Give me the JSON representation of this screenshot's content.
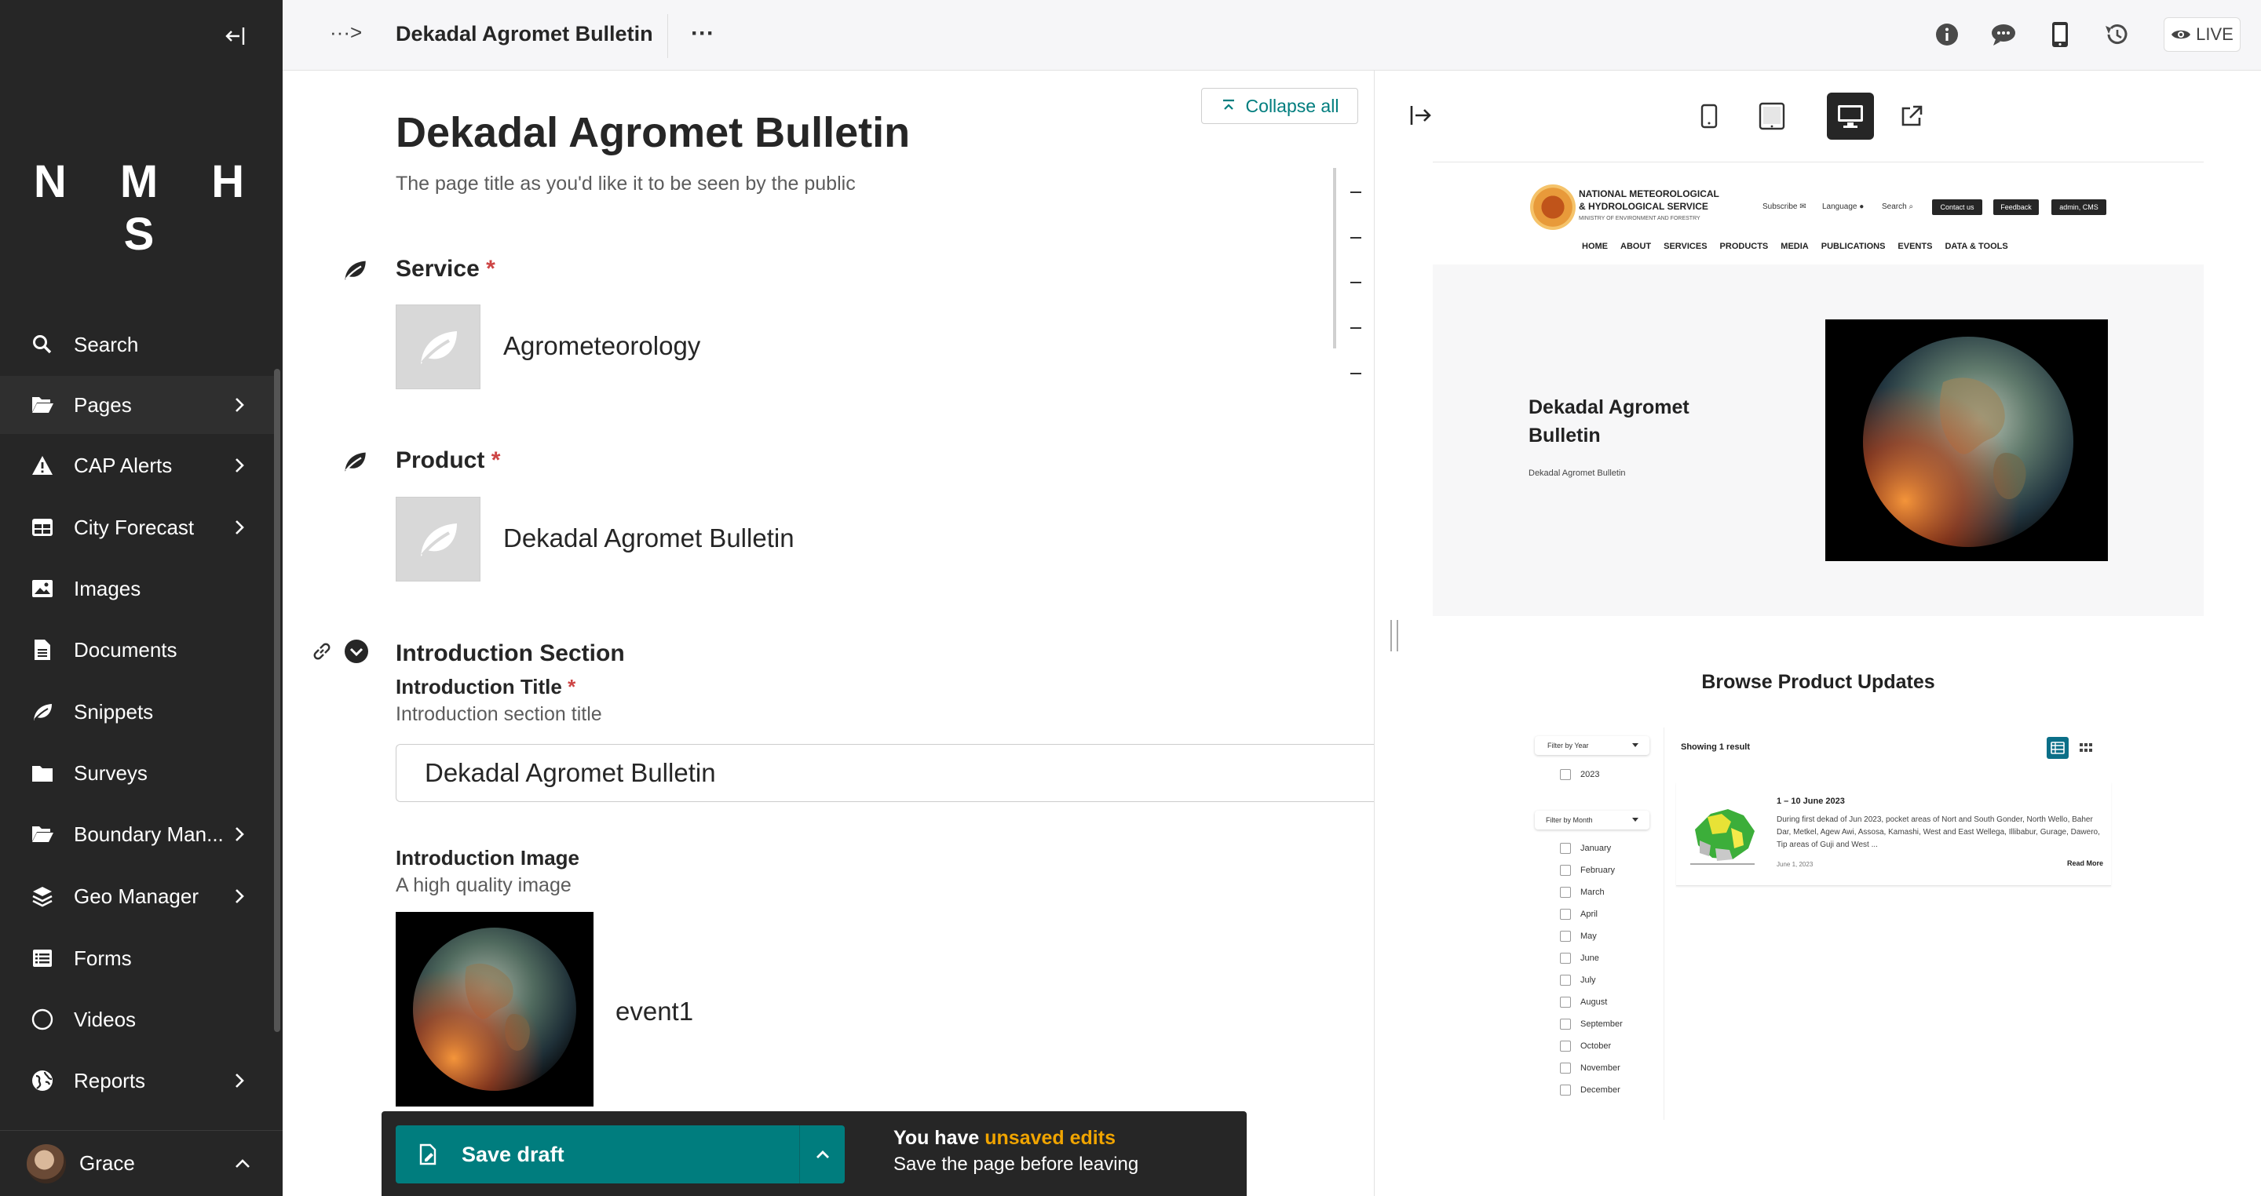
{
  "sidebar": {
    "logo": "N M H S",
    "items": [
      {
        "label": "Search",
        "icon": "search-icon"
      },
      {
        "label": "Pages",
        "icon": "folder-open-icon"
      },
      {
        "label": "CAP Alerts",
        "icon": "warning-icon"
      },
      {
        "label": "City Forecast",
        "icon": "table-icon"
      },
      {
        "label": "Images",
        "icon": "image-icon"
      },
      {
        "label": "Documents",
        "icon": "document-icon"
      },
      {
        "label": "Snippets",
        "icon": "snippet-icon"
      },
      {
        "label": "Surveys",
        "icon": "folder-icon"
      },
      {
        "label": "Boundary Man...",
        "icon": "folder-open-icon"
      },
      {
        "label": "Geo Manager",
        "icon": "layers-icon"
      },
      {
        "label": "Forms",
        "icon": "list-icon"
      },
      {
        "label": "Videos",
        "icon": "circle-icon"
      },
      {
        "label": "Reports",
        "icon": "globe-icon"
      }
    ],
    "user": {
      "name": "Grace"
    }
  },
  "topbar": {
    "breadcrumb": "···>",
    "title": "Dekadal Agromet Bulletin",
    "more": "···",
    "live_label": "LIVE"
  },
  "editor": {
    "collapse_all": "Collapse all",
    "page_title": "Dekadal Agromet Bulletin",
    "page_title_help": "The page title as you'd like it to be seen by the public",
    "service": {
      "label": "Service",
      "required": "*",
      "value": "Agrometeorology"
    },
    "product": {
      "label": "Product",
      "required": "*",
      "value": "Dekadal Agromet Bulletin"
    },
    "intro_section": {
      "heading": "Introduction Section",
      "title_label": "Introduction Title",
      "title_required": "*",
      "title_help": "Introduction section title",
      "title_value": "Dekadal Agromet Bulletin",
      "image_label": "Introduction Image",
      "image_help": "A high quality image",
      "image_name": "event1"
    }
  },
  "savebar": {
    "save_label": "Save draft",
    "msg_prefix": "You have ",
    "msg_highlight": "unsaved edits",
    "msg_sub": "Save the page before leaving"
  },
  "preview": {
    "site": {
      "name_line1": "NATIONAL METEOROLOGICAL",
      "name_line2": "& HYDROLOGICAL SERVICE",
      "name_line3": "MINISTRY OF ENVIRONMENT AND FORESTRY",
      "subscribe": "Subscribe",
      "language": "Language",
      "search": "Search",
      "btn_contact": "Contact us",
      "btn_feedback": "Feedback",
      "btn_admin": "admin, CMS",
      "nav": [
        "HOME",
        "ABOUT",
        "SERVICES",
        "PRODUCTS",
        "MEDIA",
        "PUBLICATIONS",
        "EVENTS",
        "DATA & TOOLS"
      ],
      "hero_title": "Dekadal Agromet Bulletin",
      "hero_sub": "Dekadal Agromet Bulletin",
      "browse_title": "Browse Product Updates",
      "filter_year": "Filter by Year",
      "years": [
        "2023"
      ],
      "filter_month": "Filter by Month",
      "months": [
        "January",
        "February",
        "March",
        "April",
        "May",
        "June",
        "July",
        "August",
        "September",
        "October",
        "November",
        "December"
      ],
      "showing": "Showing 1 result",
      "result": {
        "title": "1 – 10 June 2023",
        "desc": "During first dekad of Jun 2023, pocket areas of Nort and South Gonder, North Wello, Baher Dar, Metkel, Agew Awi, Assosa, Kamashi, West and East Wellega, Illibabur, Gurage, Dawero, Tip areas of Guji and West ...",
        "date": "June 1, 2023",
        "read_more": "Read More"
      }
    }
  },
  "colors": {
    "teal": "#007d7e",
    "sidebar": "#262626",
    "warning": "#f0a400",
    "required": "#cd4444"
  }
}
